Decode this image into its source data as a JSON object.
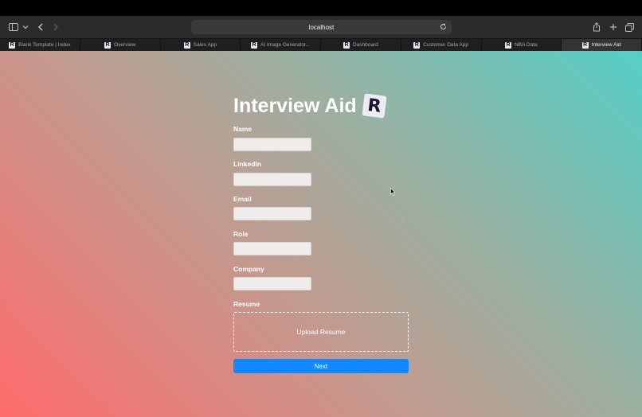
{
  "browser": {
    "address": "localhost",
    "tabs": [
      {
        "label": "Blank Template | Index",
        "favicon": "R",
        "active": false
      },
      {
        "label": "Overview",
        "favicon": "R",
        "active": false
      },
      {
        "label": "Sales App",
        "favicon": "R",
        "active": false
      },
      {
        "label": "AI Image Generator...",
        "favicon": "R",
        "active": false
      },
      {
        "label": "Dashboard",
        "favicon": "R",
        "active": false
      },
      {
        "label": "Customer Data App",
        "favicon": "R",
        "active": false
      },
      {
        "label": "NBA Data",
        "favicon": "R",
        "active": false
      },
      {
        "label": "Interview Aid",
        "favicon": "R",
        "active": true
      }
    ],
    "icons": [
      "sidebar-icon",
      "chevron-down-icon",
      "back-icon",
      "forward-icon",
      "reload-icon",
      "share-icon",
      "new-tab-icon",
      "tab-overview-icon"
    ]
  },
  "app": {
    "title": "Interview Aid",
    "logo_letter": "R",
    "fields": [
      {
        "label": "Name",
        "value": "",
        "placeholder": ""
      },
      {
        "label": "LinkedIn",
        "value": "",
        "placeholder": ""
      },
      {
        "label": "Email",
        "value": "",
        "placeholder": ""
      },
      {
        "label": "Role",
        "value": "",
        "placeholder": ""
      },
      {
        "label": "Company",
        "value": "",
        "placeholder": ""
      }
    ],
    "resume_label": "Resume",
    "upload_label": "Upload Resume",
    "next_label": "Next"
  },
  "colors": {
    "gradient_top_right": "#55cfc7",
    "gradient_bottom_left": "#ff6b6b",
    "button": "#1188ff"
  }
}
